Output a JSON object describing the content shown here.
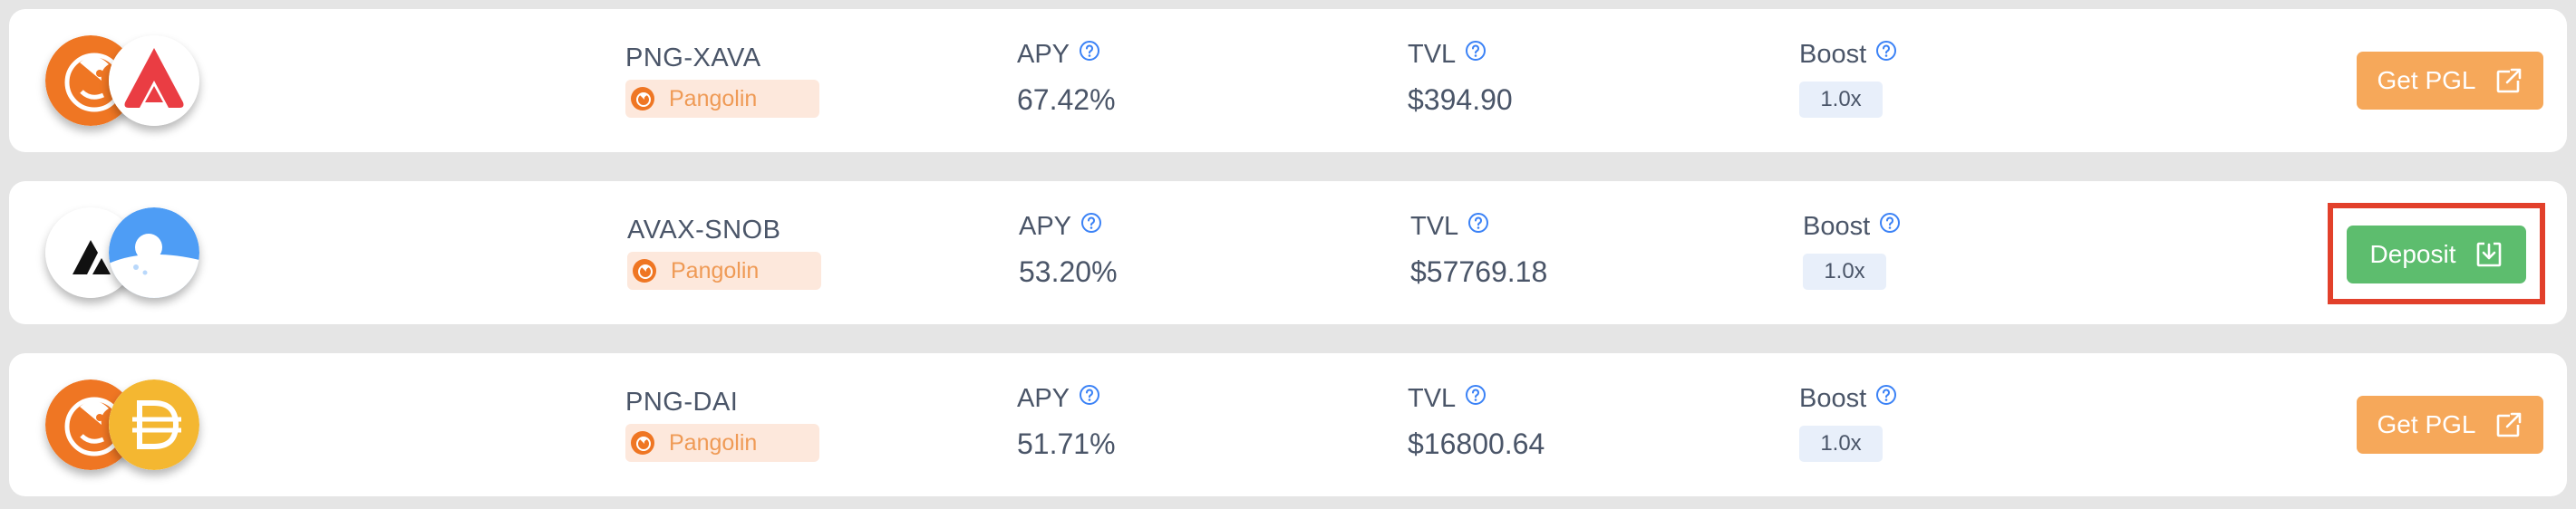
{
  "colors": {
    "pangolin_orange": "#ef7623",
    "get_pgl_button": "#f6a85a",
    "deposit_button": "#5dbd6e",
    "highlight": "#e2402b",
    "help_icon": "#3b82f6"
  },
  "rows": [
    {
      "pair": "PNG-XAVA",
      "platform": "Pangolin",
      "apy_label": "APY",
      "apy_value": "67.42%",
      "tvl_label": "TVL",
      "tvl_value": "$394.90",
      "boost_label": "Boost",
      "boost_value": "1.0x",
      "action_label": "Get PGL",
      "action_icon": "external-link-icon",
      "token_icons": [
        "png-token-icon",
        "xava-token-icon"
      ]
    },
    {
      "pair": "AVAX-SNOB",
      "platform": "Pangolin",
      "apy_label": "APY",
      "apy_value": "53.20%",
      "tvl_label": "TVL",
      "tvl_value": "$57769.18",
      "boost_label": "Boost",
      "boost_value": "1.0x",
      "action_label": "Deposit",
      "action_icon": "download-icon",
      "token_icons": [
        "avax-token-icon",
        "snob-token-icon"
      ]
    },
    {
      "pair": "PNG-DAI",
      "platform": "Pangolin",
      "apy_label": "APY",
      "apy_value": "51.71%",
      "tvl_label": "TVL",
      "tvl_value": "$16800.64",
      "boost_label": "Boost",
      "boost_value": "1.0x",
      "action_label": "Get PGL",
      "action_icon": "external-link-icon",
      "token_icons": [
        "png-token-icon",
        "dai-token-icon"
      ]
    }
  ]
}
